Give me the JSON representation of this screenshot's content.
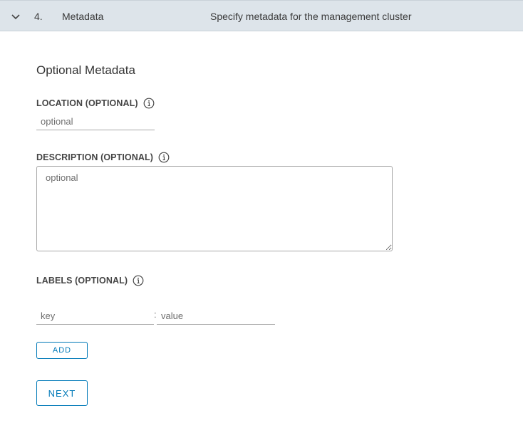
{
  "step": {
    "number": "4.",
    "title": "Metadata",
    "description": "Specify metadata for the management cluster",
    "icon": "chevron-down-icon"
  },
  "form": {
    "section_title": "Optional Metadata",
    "location": {
      "label": "LOCATION (OPTIONAL)",
      "placeholder": "optional",
      "value": ""
    },
    "description": {
      "label": "DESCRIPTION (OPTIONAL)",
      "placeholder": "optional",
      "value": ""
    },
    "labels": {
      "label": "LABELS (OPTIONAL)",
      "key_placeholder": "key",
      "value_placeholder": "value",
      "separator": ":"
    },
    "add_label": "ADD",
    "next_label": "NEXT"
  },
  "colors": {
    "accent": "#0079b8",
    "header_bg": "#dde4ea"
  }
}
